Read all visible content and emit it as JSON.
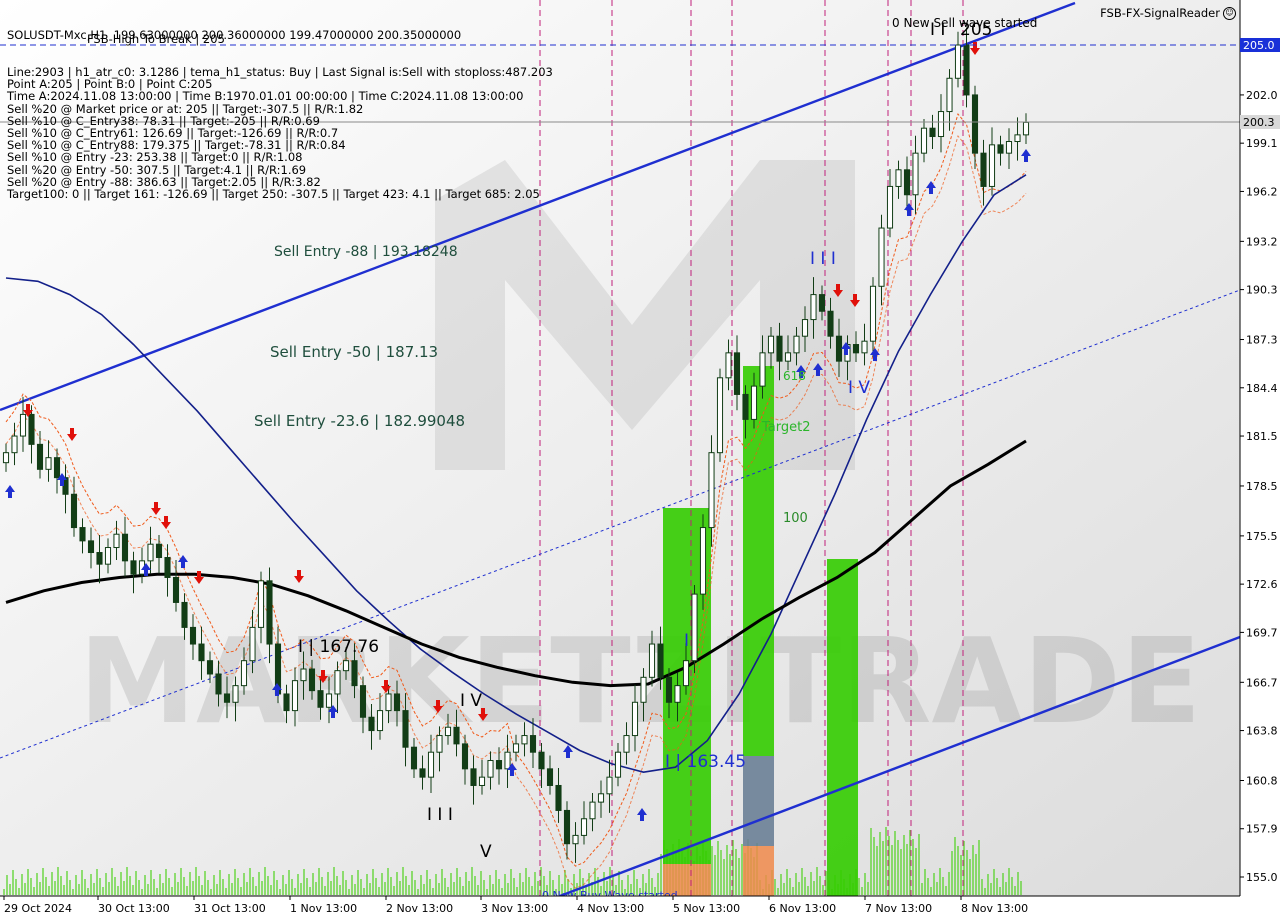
{
  "header": {
    "symbol_line": "SOLUSDT-Mxc,H1  199.63000000 200.36000000 199.47000000 200.35000000",
    "info_lines": [
      "Line:2903 | h1_atr_c0: 3.1286 | tema_h1_status: Buy | Last Signal is:Sell with stoploss:487.203",
      "Point A:205 | Point B:0 | Point C:205",
      "Time A:2024.11.08 13:00:00 | Time B:1970.01.01 00:00:00 | Time C:2024.11.08 13:00:00",
      "Sell %20 @ Market price or at: 205 || Target:-307.5 || R/R:1.82",
      "Sell %10 @ C_Entry38: 78.31 || Target:-205 || R/R:0.69",
      "Sell %10 @ C_Entry61: 126.69 || Target:-126.69 || R/R:0.7",
      "Sell %10 @ C_Entry88: 179.375 || Target:-78.31 || R/R:0.84",
      "Sell %10 @ Entry -23: 253.38 || Target:0 || R/R:1.08",
      "Sell %20 @ Entry -50: 307.5 || Target:4.1 || R/R:1.69",
      "Sell %20 @ Entry -88: 386.63 || Target:2.05 || R/R:3.82",
      "Target100: 0 || Target 161: -126.69 || Target 250: -307.5 || Target 423: 4.1 || Target 685: 2.05"
    ],
    "overlap_label": "FSB-High To Break | 205",
    "signal_reader": "FSB-FX-SignalReader"
  },
  "watermark": "MARKETZITRADE",
  "annotations": {
    "sell_entry_88": "Sell Entry -88 | 193.18248",
    "sell_entry_50": "Sell Entry -50 | 187.13",
    "sell_entry_23": "Sell Entry -23.6 | 182.99048",
    "new_sell_wave": "0 New Sell wave started",
    "new_buy_wave": "0 New Buy Wave started",
    "peak_label": "205",
    "wave_labels": [
      "I | 167.76",
      "I V",
      "I I I",
      "V",
      "I",
      "I | 163.45",
      "I I I",
      "I V",
      "I I"
    ],
    "target2": "Target2",
    "target100": "100",
    "target_618": "618"
  },
  "price_markers": {
    "level_205": "205.0",
    "level_current": "200.3"
  },
  "chart_data": {
    "type": "candlestick",
    "title": "SOLUSDT-Mxc,H1",
    "ylim": [
      154.2,
      209.0
    ],
    "y_ticks": [
      "202.0",
      "199.1",
      "196.2",
      "193.2",
      "190.3",
      "187.3",
      "184.4",
      "181.5",
      "178.5",
      "175.5",
      "172.6",
      "169.7",
      "166.7",
      "163.8",
      "160.8",
      "157.9",
      "155.0"
    ],
    "y_tick_values": [
      202.0,
      199.1,
      196.2,
      193.2,
      190.3,
      187.3,
      184.4,
      181.5,
      178.5,
      175.5,
      172.6,
      169.7,
      166.7,
      163.8,
      160.8,
      157.9,
      155.0
    ],
    "x_ticks": [
      "29 Oct 2024",
      "30 Oct 13:00",
      "31 Oct 13:00",
      "1 Nov 13:00",
      "2 Nov 13:00",
      "3 Nov 13:00",
      "4 Nov 13:00",
      "5 Nov 13:00",
      "6 Nov 13:00",
      "7 Nov 13:00",
      "8 Nov 13:00"
    ],
    "close_series": [
      180.5,
      181.5,
      182.8,
      181.0,
      179.5,
      180.2,
      179.0,
      178.0,
      176.0,
      175.2,
      174.5,
      173.8,
      174.8,
      175.6,
      174.0,
      173.2,
      174.0,
      175.0,
      174.2,
      173.0,
      171.5,
      170.0,
      169.0,
      168.0,
      167.2,
      166.0,
      165.5,
      166.5,
      168.0,
      170.0,
      172.8,
      169.0,
      166.0,
      165.0,
      166.8,
      167.5,
      166.2,
      165.2,
      166.0,
      167.4,
      168.0,
      166.5,
      164.6,
      163.8,
      165.0,
      166.0,
      165.0,
      162.8,
      161.5,
      161.0,
      162.5,
      163.5,
      164.0,
      163.0,
      161.5,
      160.5,
      161.0,
      162.0,
      161.5,
      162.5,
      163.0,
      163.5,
      162.5,
      161.5,
      160.5,
      159.0,
      157.0,
      157.5,
      158.5,
      159.5,
      160.0,
      161.0,
      162.5,
      163.5,
      165.5,
      167.0,
      169.0,
      167.0,
      165.5,
      166.5,
      168.0,
      172.0,
      176.0,
      180.5,
      185.0,
      186.5,
      184.0,
      182.5,
      184.5,
      186.5,
      187.5,
      186.0,
      186.5,
      187.5,
      188.5,
      190.0,
      189.0,
      187.5,
      186.0,
      187.0,
      186.5,
      187.2,
      190.5,
      194.0,
      196.5,
      197.5,
      196.0,
      198.5,
      200.0,
      199.5,
      201.0,
      203.0,
      205.0,
      202.0,
      198.5,
      196.5,
      199.0,
      198.5,
      199.2,
      199.6,
      200.35
    ],
    "tema_fast": [
      191.0,
      190.8,
      190.0,
      188.8,
      187.0,
      185.0,
      183.0,
      180.8,
      178.6,
      176.4,
      174.3,
      172.2,
      170.4,
      168.7,
      167.3,
      166.0,
      164.8,
      163.7,
      162.6,
      161.8,
      161.3,
      161.6,
      163.2,
      166.0,
      169.6,
      173.8,
      178.0,
      182.5,
      186.6,
      190.0,
      193.2,
      196.0,
      197.2
    ],
    "ema_slow": [
      171.5,
      172.2,
      172.7,
      173.0,
      173.2,
      173.2,
      173.0,
      172.6,
      171.9,
      171.0,
      170.0,
      169.0,
      168.2,
      167.6,
      167.1,
      166.7,
      166.5,
      166.6,
      167.6,
      169.0,
      170.5,
      171.8,
      173.0,
      174.5,
      176.5,
      178.5,
      179.8,
      181.2
    ],
    "levels": {
      "point_a": 205,
      "point_c": 205,
      "sell_entry_88": 193.18248,
      "sell_entry_50": 187.13,
      "sell_entry_23_6": 182.99048,
      "wave_i_low": 163.45,
      "wave_i_high": 167.76,
      "current_price": 200.35
    }
  },
  "colors": {
    "background": "#ffffff",
    "bull_candle": "#1b5e20",
    "bear_candle": "#1b5e20",
    "channel": "#1f2fd0",
    "tema_line": "#13208a",
    "slow_ma": "#000000",
    "stop_band": "#f05a1a",
    "green_box": "#33cc00",
    "grey_box": "#6a7f96",
    "orange_box": "#f08a4b",
    "vline": "#c0207a",
    "level_205_bg": "#1930d8",
    "current_bg": "#d8d8d8"
  }
}
